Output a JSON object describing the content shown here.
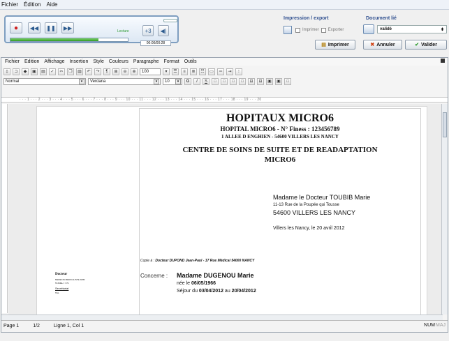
{
  "app_menu": [
    "Fichier",
    "Édition",
    "Aide"
  ],
  "player": {
    "status": "Lecture",
    "time": "00:00/00:28",
    "progress": 0.75,
    "volume_label": "+3"
  },
  "export": {
    "title": "Impression / export",
    "print_check": "Imprimer",
    "export_check": "Exporter",
    "print_button": "Imprimer"
  },
  "document": {
    "title": "Document lié",
    "status_value": "validé",
    "cancel": "Annuler",
    "validate": "Valider"
  },
  "editor": {
    "menu": [
      "Fichier",
      "Edition",
      "Affichage",
      "Insertion",
      "Style",
      "Couleurs",
      "Paragraphe",
      "Format",
      "Outils"
    ],
    "zoom": "100",
    "style": "Normal",
    "font": "Verdana",
    "size": "10",
    "ruler": "· · · 1 · · · 2 · · · 3 · · · 4 · · · 5 · · · 6 · · · 7 · · · 8 · · · 9 · · · 10 · · · 11 · · · 12 · · · 13 · · · 14 · · · 15 · · · 16 · · · 17 · · · 18 · · · 19 · · · 20"
  },
  "letter": {
    "h1": "HOPITAUX MICRO6",
    "h2": "HOPITAL MICRO6 - N° Finess : 123456789",
    "h3": "1 ALLEE D ENGHIEN - 54600 VILLERS LES NANCY",
    "h4_1": "CENTRE DE SOINS DE SUITE ET DE READAPTATION",
    "h4_2": "MICRO6",
    "addr_name": "Madame le Docteur TOUBIB Marie",
    "addr_street": "11-13 Rue de la Poupée qui Tousse",
    "addr_city": "54600 VILLERS LES NANCY",
    "date_line": "Villers les Nancy, le 20 avril 2012",
    "copy_label": "Copie à :",
    "copy_value": "Docteur DUPOND Jean-Paul - 17 Rue Médical 54000 NANCY",
    "concerne_label": "Concerne :",
    "patient": "Madame DUGENOU Marie",
    "birth_prefix": "née le",
    "birth": "06/05/1966",
    "stay_prefix": "Séjour du",
    "stay_from": "03/04/2012",
    "stay_mid": "au",
    "stay_to": "20/04/2012",
    "side_title": "Docteur",
    "side_l1": "MEDECIN MEDICALISTE AMM",
    "side_l2": "N°ADELI : 371",
    "side_l3": "Secrétariat",
    "side_l4": "TEL"
  },
  "status": {
    "page": "Page 1",
    "count": "1/2",
    "position": "Ligne 1, Col 1",
    "num": "NUM",
    "maj": "MAJ"
  }
}
